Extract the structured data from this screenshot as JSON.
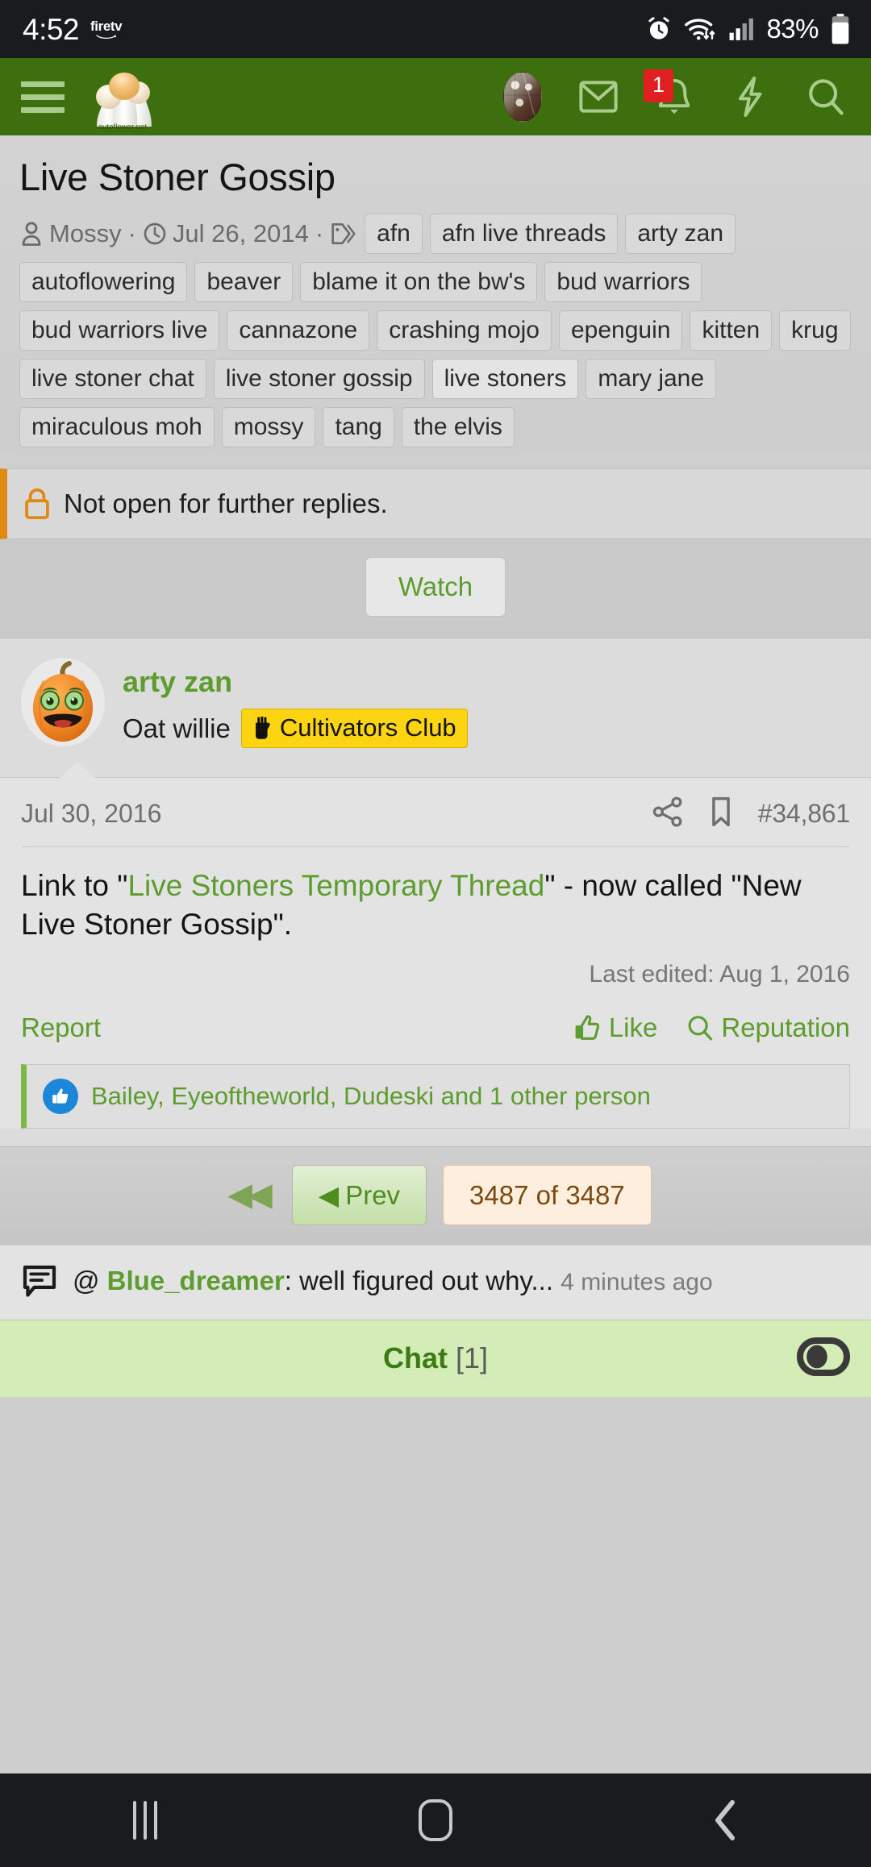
{
  "statusbar": {
    "time": "4:52",
    "brand": "firetv",
    "battery_percent": "83%",
    "icons": [
      "alarm-icon",
      "wifi-icon",
      "signal-icon",
      "battery-icon"
    ]
  },
  "appbar": {
    "menu_icon": "hamburger-menu-icon",
    "logo_caption": "autoflower.net",
    "avatar_icon": "user-avatar",
    "mail_icon": "envelope-icon",
    "alerts_icon": "bell-icon",
    "alerts_badge": "1",
    "bolt_icon": "lightning-bolt-icon",
    "search_icon": "search-icon"
  },
  "thread": {
    "title": "Live Stoner Gossip",
    "author": "Mossy",
    "start_date": "Jul 26, 2014",
    "sep": "·",
    "tags": [
      "afn",
      "afn live threads",
      "arty zan",
      "autoflowering",
      "beaver",
      "blame it on the bw's",
      "bud warriors",
      "bud warriors live",
      "cannazone",
      "crashing mojo",
      "epenguin",
      "kitten",
      "krug",
      "live stoner chat",
      "live stoner gossip",
      "live stoners",
      "mary jane",
      "miraculous moh",
      "mossy",
      "tang",
      "the elvis"
    ],
    "locked_notice": "Not open for further replies.",
    "watch_label": "Watch"
  },
  "post": {
    "username": "arty zan",
    "user_title": "Oat willie",
    "club_badge": "Cultivators Club",
    "date": "Jul 30, 2016",
    "post_number": "#34,861",
    "body_prefix": "Link to \"",
    "body_link": "Live Stoners Temporary Thread",
    "body_suffix": "\" - now called \"New Live Stoner Gossip\".",
    "last_edited": "Last edited: Aug 1, 2016",
    "report_label": "Report",
    "like_label": "Like",
    "reputation_label": "Reputation",
    "likes_text": "Bailey, Eyeoftheworld, Dudeski and 1 other person"
  },
  "pager": {
    "first_label": "◀◀",
    "prev_label": "Prev",
    "prev_arrow": "◀",
    "count_label": "3487 of 3487"
  },
  "chat_notice": {
    "at": "@",
    "user": "Blue_dreamer",
    "message": ": well figured out why...",
    "time": "4 minutes ago"
  },
  "chat_bar": {
    "label": "Chat",
    "count": "[1]"
  },
  "navbar": {
    "recents": "recents-icon",
    "home": "home-icon",
    "back": "back-icon"
  },
  "colors": {
    "brand_green": "#3e6f0f",
    "link_green": "#5d9c2e",
    "badge_red": "#e02020",
    "badge_yellow": "#fcd411",
    "lock_orange": "#e08a14",
    "chat_bg": "#d4ecb6"
  }
}
